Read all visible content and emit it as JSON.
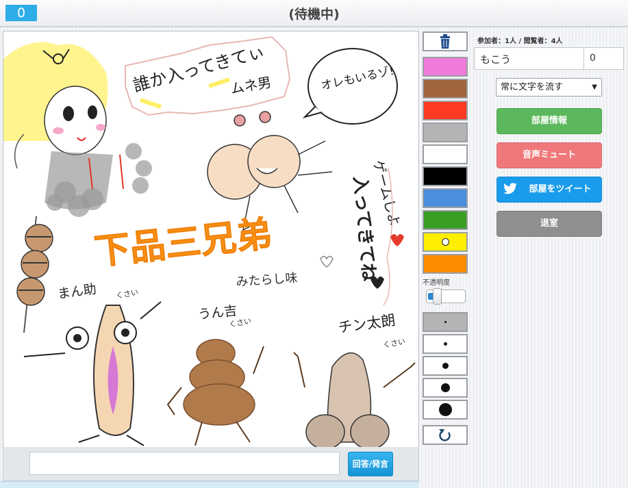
{
  "header": {
    "score": "0",
    "status": "(待機中)"
  },
  "canvas": {
    "texts": [
      "誰か入ってきてぃ",
      "ムネ男",
      "オレもいるゾ!",
      "ゲームしよ",
      "入ってきてね",
      "下品三兄弟",
      "みたらし味",
      "まん助",
      "くさい",
      "うん吉",
      "くさい",
      "チン太朗",
      "くさい"
    ]
  },
  "tools": {
    "trash_icon": "trash-icon",
    "colors": [
      "#f07ad8",
      "#a0653c",
      "#ff3a22",
      "#b4b4b4",
      "#ffffff",
      "#000000",
      "#4a8fde",
      "#3a9e24",
      "#ffee00",
      "#ff8c00"
    ],
    "selected_color": "#ffee00",
    "opacity_label": "不透明度",
    "opacity_value": 0.2,
    "brush_sizes": [
      1,
      2,
      4,
      6,
      9
    ],
    "undo_icon": "undo-icon"
  },
  "room": {
    "info_text": "参加者：1人 / 閲覧者：4人",
    "players": [
      {
        "name": "もこう",
        "score": "0"
      }
    ],
    "mode_select": "常に文字を流す",
    "buttons": {
      "info": "部屋情報",
      "mute": "音声ミュート",
      "tweet": "部屋をツイート",
      "exit": "退室"
    }
  },
  "chat": {
    "input_value": "",
    "submit_label": "回答/発言"
  }
}
